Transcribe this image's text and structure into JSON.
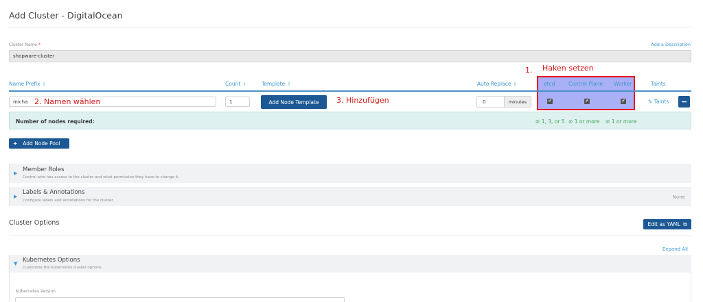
{
  "page": {
    "title": "Add Cluster - DigitalOcean"
  },
  "cluster_name": {
    "label": "Cluster Name",
    "required_mark": "*",
    "value": "shopware-cluster",
    "add_description": "Add a Description"
  },
  "node_pool_table": {
    "headers": {
      "name_prefix": "Name Prefix",
      "count": "Count",
      "template": "Template",
      "auto_replace": "Auto Replace",
      "etcd": "etcd",
      "control_plane": "Control Plane",
      "worker": "Worker",
      "taints": "Taints"
    },
    "row": {
      "name_prefix": "micha",
      "count": "1",
      "template_button": "Add Node Template",
      "auto_replace_value": "0",
      "auto_replace_unit": "minutes",
      "etcd": true,
      "control_plane": true,
      "worker": true,
      "taints_link": "Taints",
      "remove_button": "−"
    },
    "requirements": {
      "label": "Number of nodes required:",
      "etcd": "1, 3, or 5",
      "control_plane": "1 or more",
      "worker": "1 or more"
    },
    "add_node_pool": "Add Node Pool"
  },
  "annotations": {
    "step1_number": "1.",
    "step1_text": "Haken setzen",
    "step2": "2. Namen wählen",
    "step3": "3. Hinzufügen",
    "box_color": "#e8141c"
  },
  "sections": {
    "member_roles": {
      "title": "Member Roles",
      "subtitle": "Control who has access to the cluster and what permission they have to change it."
    },
    "labels": {
      "title": "Labels & Annotations",
      "subtitle": "Configure labels and annotations for the cluster.",
      "summary": "None"
    }
  },
  "cluster_options": {
    "title": "Cluster Options",
    "edit_yaml": "Edit as YAML",
    "expand_all": "Expand All",
    "kubernetes": {
      "title": "Kubernetes Options",
      "subtitle": "Customize the kubernetes cluster options",
      "version_label": "Kubernetes Version"
    }
  },
  "colors": {
    "primary": "#1c5894",
    "link": "#3d98d3",
    "role_highlight": "#aab0f5",
    "requirements_bg": "#dff1ef",
    "success": "#3aa35a"
  }
}
